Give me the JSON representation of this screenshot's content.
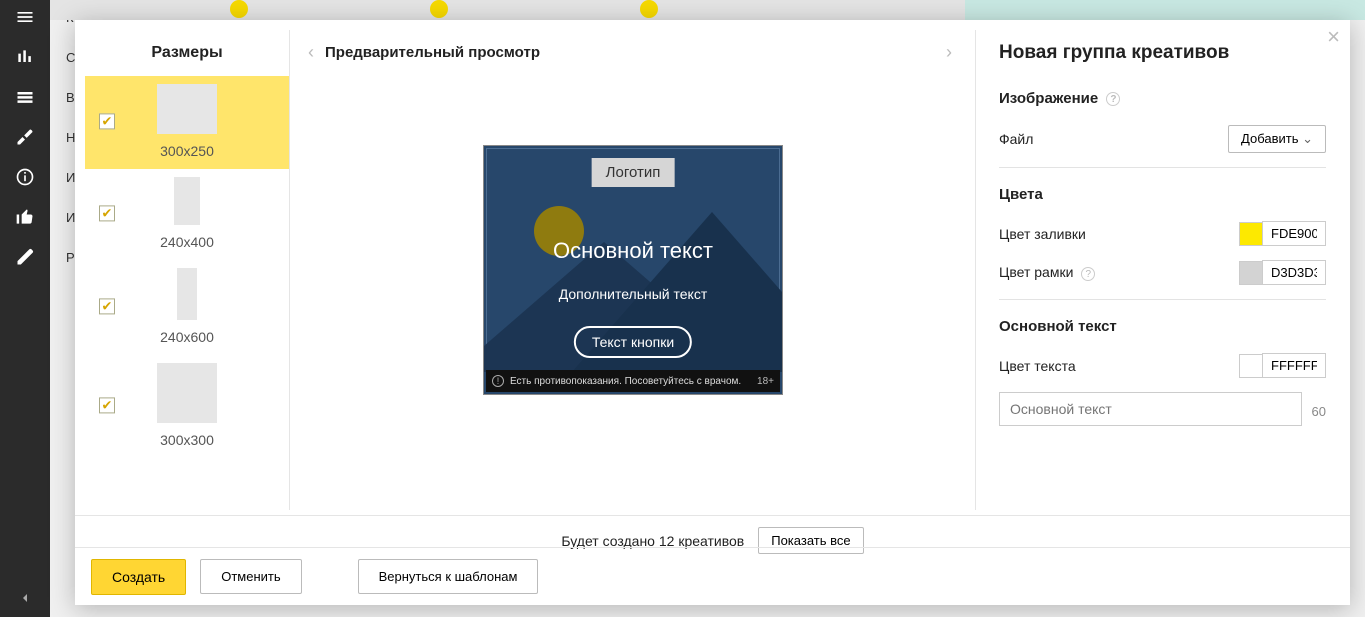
{
  "bg_sidebar_letters": [
    "К",
    "С",
    "B",
    "Н",
    "И",
    "И",
    "P"
  ],
  "sizes": {
    "title": "Размеры",
    "items": [
      {
        "label": "300x250",
        "selected": true,
        "checked": true
      },
      {
        "label": "240x400",
        "selected": false,
        "checked": true
      },
      {
        "label": "240x600",
        "selected": false,
        "checked": true
      },
      {
        "label": "300x300",
        "selected": false,
        "checked": true
      }
    ]
  },
  "preview": {
    "title": "Предварительный просмотр",
    "creative": {
      "logo": "Логотип",
      "main_text": "Основной текст",
      "sub_text": "Дополнительный текст",
      "cta": "Текст кнопки",
      "disclaimer": "Есть противопоказания. Посоветуйтесь с врачом.",
      "age": "18+"
    }
  },
  "settings": {
    "title": "Новая группа креативов",
    "image_section": "Изображение",
    "file_label": "Файл",
    "add_button": "Добавить",
    "colors_section": "Цвета",
    "fill_label": "Цвет заливки",
    "fill_value": "FDE900",
    "fill_swatch": "#FDE900",
    "border_label": "Цвет рамки",
    "border_value": "D3D3D3",
    "border_swatch": "#D3D3D3",
    "main_text_section": "Основной текст",
    "text_color_label": "Цвет текста",
    "text_color_value": "FFFFFF",
    "text_color_swatch": "#FFFFFF",
    "text_placeholder": "Основной текст",
    "text_counter": "60"
  },
  "info_bar": {
    "count_text": "Будет создано 12 креативов",
    "show_all": "Показать все"
  },
  "toolbar": {
    "create": "Создать",
    "cancel": "Отменить",
    "back": "Вернуться к шаблонам"
  }
}
